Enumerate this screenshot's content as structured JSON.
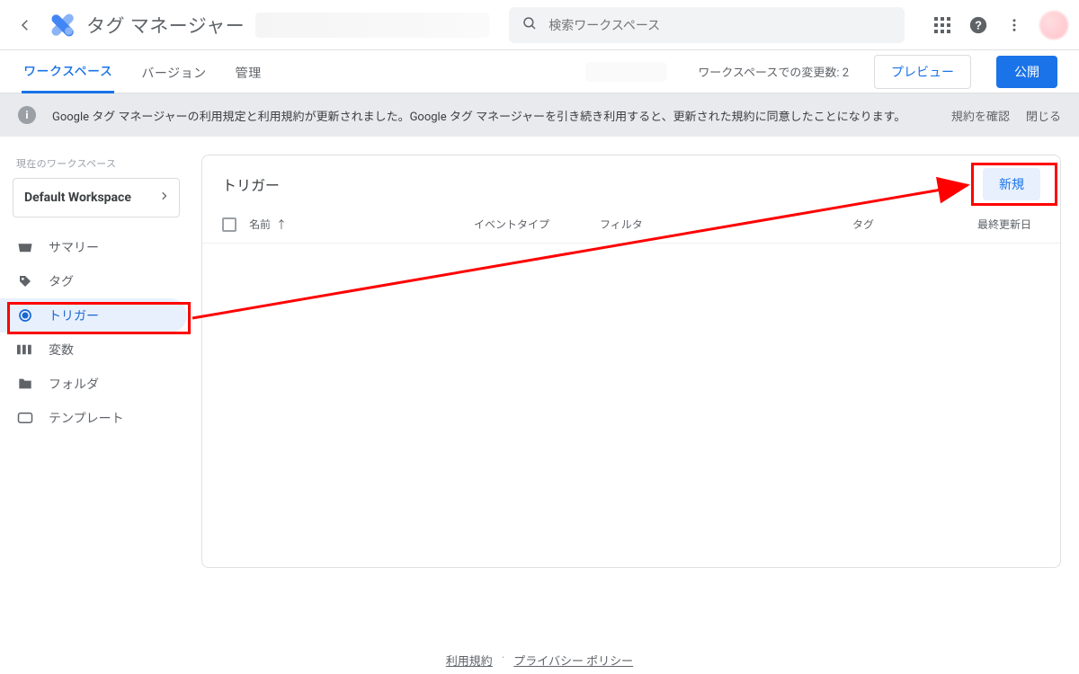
{
  "header": {
    "product_name": "タグ マネージャー",
    "search_placeholder": "検索ワークスペース"
  },
  "tabs": {
    "workspace": "ワークスペース",
    "versions": "バージョン",
    "admin": "管理",
    "changes_label": "ワークスペースでの変更数: 2",
    "preview": "プレビュー",
    "publish": "公開"
  },
  "notice": {
    "message": "Google タグ マネージャーの利用規定と利用規約が更新されました。Google タグ マネージャーを引き続き利用すると、更新された規約に同意したことになります。",
    "confirm": "規約を確認",
    "close": "閉じる"
  },
  "sidebar": {
    "ws_label": "現在のワークスペース",
    "ws_name": "Default Workspace",
    "items": {
      "summary": "サマリー",
      "tags": "タグ",
      "triggers": "トリガー",
      "variables": "変数",
      "folders": "フォルダ",
      "templates": "テンプレート"
    }
  },
  "content": {
    "title": "トリガー",
    "new_button": "新規",
    "columns": {
      "name": "名前",
      "sort_dir": "↑",
      "event_type": "イベントタイプ",
      "filter": "フィルタ",
      "tag": "タグ",
      "updated": "最終更新日"
    }
  },
  "footer": {
    "terms": "利用規約",
    "privacy": "プライバシー ポリシー"
  }
}
